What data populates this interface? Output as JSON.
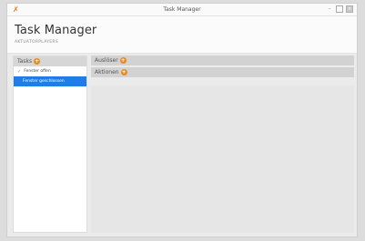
{
  "window": {
    "title": "Task Manager",
    "minimize": "–",
    "maximize": "□",
    "close": "×",
    "icon": "app-icon"
  },
  "header": {
    "title": "Task Manager",
    "subtitle": "AKTUATORPLAYERS"
  },
  "sidebar": {
    "header_label": "Tasks",
    "add_symbol": "+",
    "items": [
      {
        "label": "Fenster offen",
        "check": "✓",
        "selected": false
      },
      {
        "label": "Fenster geschlossen",
        "selected": true
      }
    ]
  },
  "main": {
    "sections": [
      {
        "label": "Auslöser",
        "add_symbol": "+"
      },
      {
        "label": "Aktionen",
        "add_symbol": "+"
      }
    ]
  },
  "colors": {
    "accent": "#e8891e",
    "selection": "#1e7ee6"
  }
}
